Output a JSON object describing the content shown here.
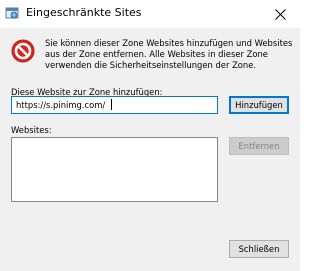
{
  "window": {
    "title": "Eingeschränkte Sites",
    "close_label": "Schließen"
  },
  "info": {
    "text": "Sie können dieser Zone Websites hinzufügen und Websites aus der Zone entfernen. Alle Websites in dieser Zone verwenden die Sicherheitseinstellungen der Zone.",
    "icon": "prohibited-icon"
  },
  "add_site": {
    "label": "Diese Website zur Zone hinzufügen:",
    "value": "https://s.pinimg.com/",
    "add_button": "Hinzufügen"
  },
  "sites": {
    "label": "Websites:",
    "items": [],
    "remove_button": "Entfernen"
  },
  "footer": {
    "close_button": "Schließen"
  },
  "colors": {
    "accent": "#0078d7",
    "warning_red": "#d6281c"
  }
}
